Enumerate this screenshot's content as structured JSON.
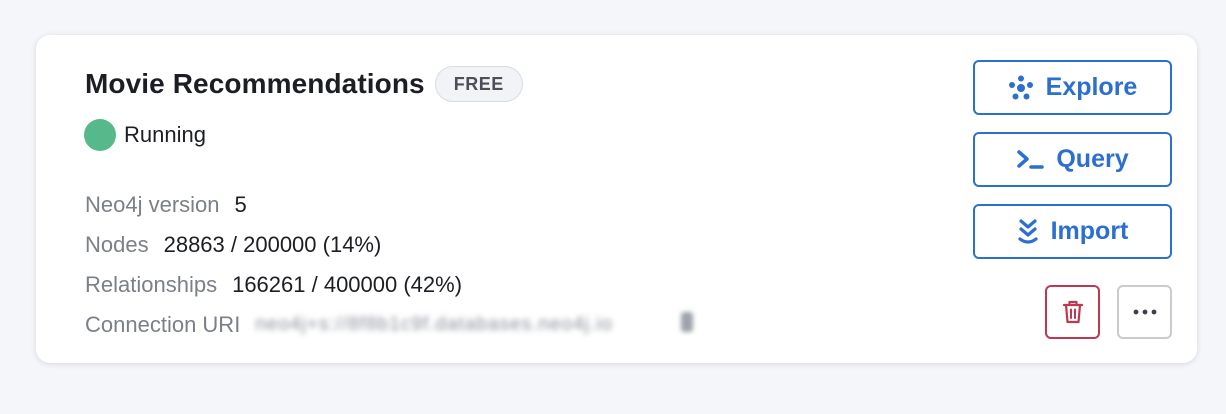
{
  "instance": {
    "name": "Movie Recommendations",
    "tier_badge": "FREE",
    "status": "Running",
    "status_color": "#56b98b"
  },
  "details": [
    {
      "label": "Neo4j version",
      "value": "5"
    },
    {
      "label": "Nodes",
      "value": "28863 / 200000 (14%)"
    },
    {
      "label": "Relationships",
      "value": "166261 / 400000 (42%)"
    },
    {
      "label": "Connection URI",
      "value": "neo4j+s://8f8b1c9f.databases.neo4j.io"
    }
  ],
  "actions": {
    "explore_label": "Explore",
    "query_label": "Query",
    "import_label": "Import",
    "explore_icon": "explore-icon",
    "query_icon": "terminal-icon",
    "import_icon": "import-icon",
    "delete_icon": "trash-icon",
    "more_icon": "more-horizontal-icon"
  },
  "colors": {
    "accent": "#2b6fd1",
    "danger": "#c0384f",
    "running": "#56b98b"
  }
}
